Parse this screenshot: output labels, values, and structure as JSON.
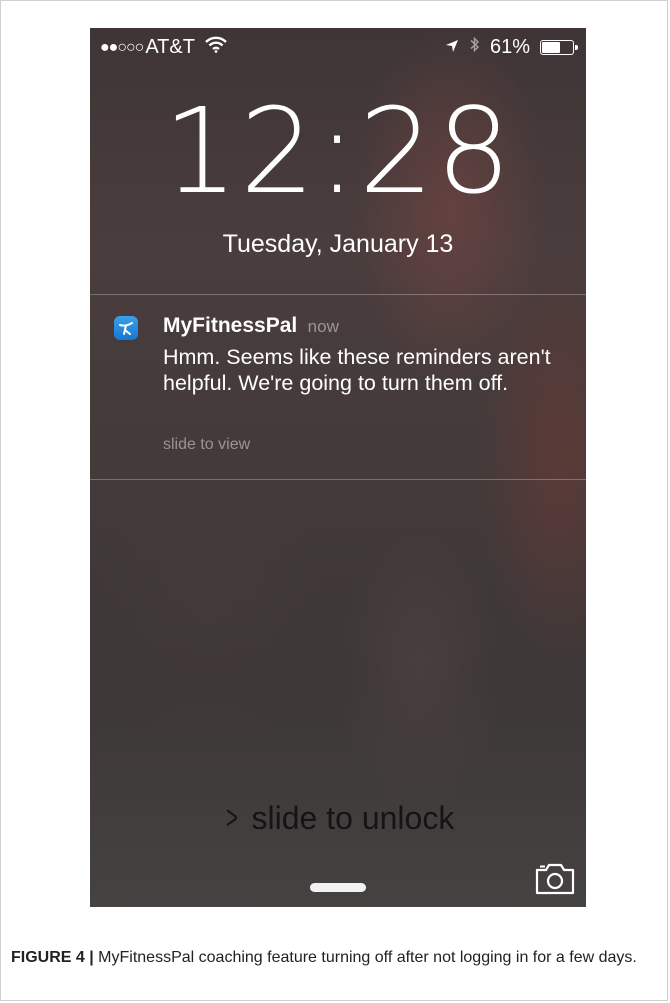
{
  "status_bar": {
    "signal_dots": "●●○○○",
    "carrier": "AT&T",
    "battery_percent": "61%",
    "battery_level": 0.61
  },
  "lock_screen": {
    "time": "12:28",
    "date": "Tuesday, January 13"
  },
  "notification": {
    "app_name": "MyFitnessPal",
    "time": "now",
    "message": "Hmm. Seems like these reminders aren't helpful. We're going to turn them off.",
    "hint": "slide to view"
  },
  "unlock": {
    "label": "slide to unlock"
  },
  "caption": {
    "label": "FIGURE 4 |",
    "text": "MyFitnessPal coaching feature turning off after not logging in for a few days."
  },
  "colors": {
    "app_icon": "#1e88e0"
  },
  "icons": [
    "wifi-icon",
    "location-arrow-icon",
    "bluetooth-icon",
    "battery-icon",
    "camera-icon",
    "chevron-right-icon"
  ]
}
